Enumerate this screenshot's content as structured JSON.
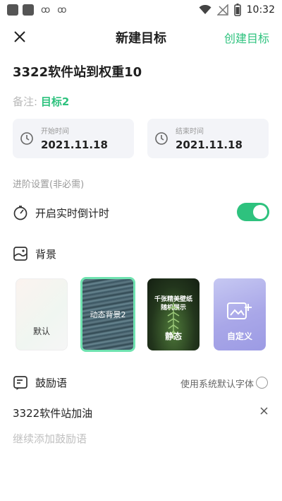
{
  "status_bar": {
    "time": "10:32",
    "left_glyphs": [
      "ꝏ",
      "ꝏ"
    ]
  },
  "header": {
    "title": "新建目标",
    "action_label": "创建目标"
  },
  "goal": {
    "title": "3322软件站到权重10"
  },
  "note": {
    "label": "备注:",
    "value": "目标2"
  },
  "dates": {
    "start": {
      "caption": "开始时间",
      "value": "2021.11.18"
    },
    "end": {
      "caption": "结束时间",
      "value": "2021.11.18"
    }
  },
  "advanced": {
    "label": "进阶设置(非必需)",
    "countdown_label": "开启实时倒计时",
    "countdown_enabled": true
  },
  "background": {
    "label": "背景",
    "options": [
      {
        "label": "默认"
      },
      {
        "label": "动态背景2",
        "selected": true
      },
      {
        "label": "静态",
        "caption_line1": "千张精美壁纸",
        "caption_line2": "随机展示"
      },
      {
        "label": "自定义"
      }
    ]
  },
  "encouragement": {
    "label": "鼓励语",
    "system_font_label": "使用系统默认字体",
    "items": [
      "3322软件站加油"
    ],
    "add_placeholder": "继续添加鼓励语"
  },
  "colors": {
    "accent": "#2ec27e",
    "selected_border": "#6fe3b0"
  }
}
